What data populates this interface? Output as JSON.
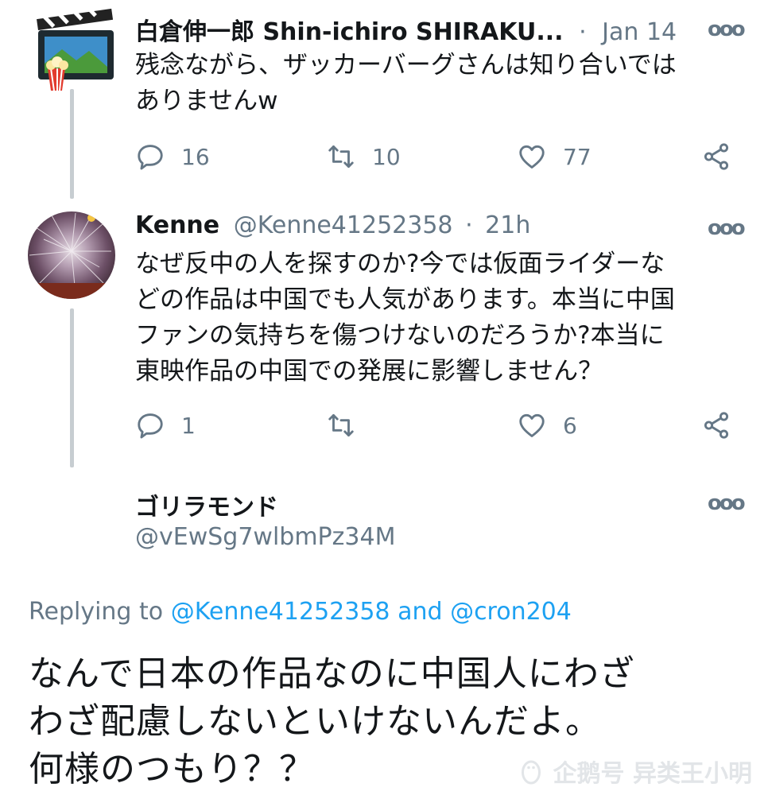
{
  "tweets": [
    {
      "name": "白倉伸一郎 Shin-ichiro SHIRAKU...",
      "handle": "",
      "separator": "·",
      "time": "Jan 14",
      "text_lines": [
        "残念ながら、ザッカーバーグさんは知り合いでは",
        "ありませんw"
      ],
      "replies": "16",
      "retweets": "10",
      "likes": "77"
    },
    {
      "name": "Kenne",
      "handle": "@Kenne41252358",
      "separator": "·",
      "time": "21h",
      "text_lines": [
        "なぜ反中の人を探すのか?今では仮面ライダーな",
        "どの作品は中国でも人気があります。本当に中国",
        "ファンの気持ちを傷つけないのだろうか?本当に",
        "東映作品の中国での発展に影響しません？"
      ],
      "replies": "1",
      "retweets": "",
      "likes": "6"
    }
  ],
  "main_tweet": {
    "name": "ゴリラモンド",
    "handle": "@vEwSg7wlbmPz34M",
    "replying_prefix": "Replying to",
    "replying_user1": "@Kenne41252358",
    "replying_and": "and",
    "replying_user2": "@cron204",
    "text_lines": [
      "なんで日本の作品なのに中国人にわざ",
      "わざ配慮しないといけないんだよ。",
      "何様のつもり？？"
    ]
  },
  "more_label": "ooo",
  "watermark": "企鹅号 异类王小明",
  "colors": {
    "link": "#1da1f2",
    "muted": "#657786",
    "thread_line": "#c7cdd1"
  }
}
